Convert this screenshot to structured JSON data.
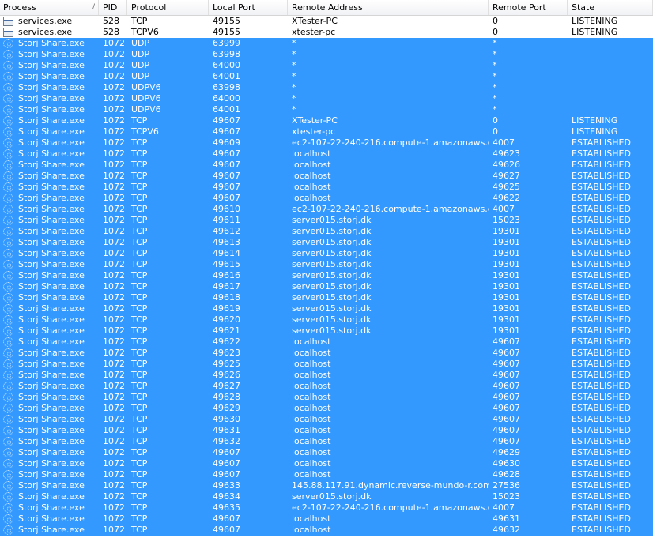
{
  "columns": [
    {
      "key": "process",
      "label": "Process",
      "sort": "/"
    },
    {
      "key": "pid",
      "label": "PID"
    },
    {
      "key": "protocol",
      "label": "Protocol"
    },
    {
      "key": "local_port",
      "label": "Local Port"
    },
    {
      "key": "remote_address",
      "label": "Remote Address"
    },
    {
      "key": "remote_port",
      "label": "Remote Port"
    },
    {
      "key": "state",
      "label": "State"
    }
  ],
  "colors": {
    "selection": "#3399ff",
    "header_bg": "#f1f2f5"
  },
  "rows": [
    {
      "icon": "services-exe-icon",
      "selected": false,
      "process": "services.exe",
      "pid": "528",
      "protocol": "TCP",
      "local_port": "49155",
      "remote_address": "XTester-PC",
      "remote_port": "0",
      "state": "LISTENING"
    },
    {
      "icon": "services-exe-icon",
      "selected": false,
      "process": "services.exe",
      "pid": "528",
      "protocol": "TCPV6",
      "local_port": "49155",
      "remote_address": "xtester-pc",
      "remote_port": "0",
      "state": "LISTENING"
    },
    {
      "icon": "storj-share-icon",
      "selected": true,
      "process": "Storj Share.exe",
      "pid": "1072",
      "protocol": "UDP",
      "local_port": "63999",
      "remote_address": "*",
      "remote_port": "*",
      "state": ""
    },
    {
      "icon": "storj-share-icon",
      "selected": true,
      "process": "Storj Share.exe",
      "pid": "1072",
      "protocol": "UDP",
      "local_port": "63998",
      "remote_address": "*",
      "remote_port": "*",
      "state": ""
    },
    {
      "icon": "storj-share-icon",
      "selected": true,
      "process": "Storj Share.exe",
      "pid": "1072",
      "protocol": "UDP",
      "local_port": "64000",
      "remote_address": "*",
      "remote_port": "*",
      "state": ""
    },
    {
      "icon": "storj-share-icon",
      "selected": true,
      "process": "Storj Share.exe",
      "pid": "1072",
      "protocol": "UDP",
      "local_port": "64001",
      "remote_address": "*",
      "remote_port": "*",
      "state": ""
    },
    {
      "icon": "storj-share-icon",
      "selected": true,
      "process": "Storj Share.exe",
      "pid": "1072",
      "protocol": "UDPV6",
      "local_port": "63998",
      "remote_address": "*",
      "remote_port": "*",
      "state": ""
    },
    {
      "icon": "storj-share-icon",
      "selected": true,
      "process": "Storj Share.exe",
      "pid": "1072",
      "protocol": "UDPV6",
      "local_port": "64000",
      "remote_address": "*",
      "remote_port": "*",
      "state": ""
    },
    {
      "icon": "storj-share-icon",
      "selected": true,
      "process": "Storj Share.exe",
      "pid": "1072",
      "protocol": "UDPV6",
      "local_port": "64001",
      "remote_address": "*",
      "remote_port": "*",
      "state": ""
    },
    {
      "icon": "storj-share-icon",
      "selected": true,
      "process": "Storj Share.exe",
      "pid": "1072",
      "protocol": "TCP",
      "local_port": "49607",
      "remote_address": "XTester-PC",
      "remote_port": "0",
      "state": "LISTENING"
    },
    {
      "icon": "storj-share-icon",
      "selected": true,
      "process": "Storj Share.exe",
      "pid": "1072",
      "protocol": "TCPV6",
      "local_port": "49607",
      "remote_address": "xtester-pc",
      "remote_port": "0",
      "state": "LISTENING"
    },
    {
      "icon": "storj-share-icon",
      "selected": true,
      "process": "Storj Share.exe",
      "pid": "1072",
      "protocol": "TCP",
      "local_port": "49609",
      "remote_address": "ec2-107-22-240-216.compute-1.amazonaws.com",
      "remote_port": "4007",
      "state": "ESTABLISHED"
    },
    {
      "icon": "storj-share-icon",
      "selected": true,
      "process": "Storj Share.exe",
      "pid": "1072",
      "protocol": "TCP",
      "local_port": "49607",
      "remote_address": "localhost",
      "remote_port": "49623",
      "state": "ESTABLISHED"
    },
    {
      "icon": "storj-share-icon",
      "selected": true,
      "process": "Storj Share.exe",
      "pid": "1072",
      "protocol": "TCP",
      "local_port": "49607",
      "remote_address": "localhost",
      "remote_port": "49626",
      "state": "ESTABLISHED"
    },
    {
      "icon": "storj-share-icon",
      "selected": true,
      "process": "Storj Share.exe",
      "pid": "1072",
      "protocol": "TCP",
      "local_port": "49607",
      "remote_address": "localhost",
      "remote_port": "49627",
      "state": "ESTABLISHED"
    },
    {
      "icon": "storj-share-icon",
      "selected": true,
      "process": "Storj Share.exe",
      "pid": "1072",
      "protocol": "TCP",
      "local_port": "49607",
      "remote_address": "localhost",
      "remote_port": "49625",
      "state": "ESTABLISHED"
    },
    {
      "icon": "storj-share-icon",
      "selected": true,
      "process": "Storj Share.exe",
      "pid": "1072",
      "protocol": "TCP",
      "local_port": "49607",
      "remote_address": "localhost",
      "remote_port": "49622",
      "state": "ESTABLISHED"
    },
    {
      "icon": "storj-share-icon",
      "selected": true,
      "process": "Storj Share.exe",
      "pid": "1072",
      "protocol": "TCP",
      "local_port": "49610",
      "remote_address": "ec2-107-22-240-216.compute-1.amazonaws.com",
      "remote_port": "4007",
      "state": "ESTABLISHED"
    },
    {
      "icon": "storj-share-icon",
      "selected": true,
      "process": "Storj Share.exe",
      "pid": "1072",
      "protocol": "TCP",
      "local_port": "49611",
      "remote_address": "server015.storj.dk",
      "remote_port": "15023",
      "state": "ESTABLISHED"
    },
    {
      "icon": "storj-share-icon",
      "selected": true,
      "process": "Storj Share.exe",
      "pid": "1072",
      "protocol": "TCP",
      "local_port": "49612",
      "remote_address": "server015.storj.dk",
      "remote_port": "19301",
      "state": "ESTABLISHED"
    },
    {
      "icon": "storj-share-icon",
      "selected": true,
      "process": "Storj Share.exe",
      "pid": "1072",
      "protocol": "TCP",
      "local_port": "49613",
      "remote_address": "server015.storj.dk",
      "remote_port": "19301",
      "state": "ESTABLISHED"
    },
    {
      "icon": "storj-share-icon",
      "selected": true,
      "process": "Storj Share.exe",
      "pid": "1072",
      "protocol": "TCP",
      "local_port": "49614",
      "remote_address": "server015.storj.dk",
      "remote_port": "19301",
      "state": "ESTABLISHED"
    },
    {
      "icon": "storj-share-icon",
      "selected": true,
      "process": "Storj Share.exe",
      "pid": "1072",
      "protocol": "TCP",
      "local_port": "49615",
      "remote_address": "server015.storj.dk",
      "remote_port": "19301",
      "state": "ESTABLISHED"
    },
    {
      "icon": "storj-share-icon",
      "selected": true,
      "process": "Storj Share.exe",
      "pid": "1072",
      "protocol": "TCP",
      "local_port": "49616",
      "remote_address": "server015.storj.dk",
      "remote_port": "19301",
      "state": "ESTABLISHED"
    },
    {
      "icon": "storj-share-icon",
      "selected": true,
      "process": "Storj Share.exe",
      "pid": "1072",
      "protocol": "TCP",
      "local_port": "49617",
      "remote_address": "server015.storj.dk",
      "remote_port": "19301",
      "state": "ESTABLISHED"
    },
    {
      "icon": "storj-share-icon",
      "selected": true,
      "process": "Storj Share.exe",
      "pid": "1072",
      "protocol": "TCP",
      "local_port": "49618",
      "remote_address": "server015.storj.dk",
      "remote_port": "19301",
      "state": "ESTABLISHED"
    },
    {
      "icon": "storj-share-icon",
      "selected": true,
      "process": "Storj Share.exe",
      "pid": "1072",
      "protocol": "TCP",
      "local_port": "49619",
      "remote_address": "server015.storj.dk",
      "remote_port": "19301",
      "state": "ESTABLISHED"
    },
    {
      "icon": "storj-share-icon",
      "selected": true,
      "process": "Storj Share.exe",
      "pid": "1072",
      "protocol": "TCP",
      "local_port": "49620",
      "remote_address": "server015.storj.dk",
      "remote_port": "19301",
      "state": "ESTABLISHED"
    },
    {
      "icon": "storj-share-icon",
      "selected": true,
      "process": "Storj Share.exe",
      "pid": "1072",
      "protocol": "TCP",
      "local_port": "49621",
      "remote_address": "server015.storj.dk",
      "remote_port": "19301",
      "state": "ESTABLISHED"
    },
    {
      "icon": "storj-share-icon",
      "selected": true,
      "process": "Storj Share.exe",
      "pid": "1072",
      "protocol": "TCP",
      "local_port": "49622",
      "remote_address": "localhost",
      "remote_port": "49607",
      "state": "ESTABLISHED"
    },
    {
      "icon": "storj-share-icon",
      "selected": true,
      "process": "Storj Share.exe",
      "pid": "1072",
      "protocol": "TCP",
      "local_port": "49623",
      "remote_address": "localhost",
      "remote_port": "49607",
      "state": "ESTABLISHED"
    },
    {
      "icon": "storj-share-icon",
      "selected": true,
      "process": "Storj Share.exe",
      "pid": "1072",
      "protocol": "TCP",
      "local_port": "49625",
      "remote_address": "localhost",
      "remote_port": "49607",
      "state": "ESTABLISHED"
    },
    {
      "icon": "storj-share-icon",
      "selected": true,
      "process": "Storj Share.exe",
      "pid": "1072",
      "protocol": "TCP",
      "local_port": "49626",
      "remote_address": "localhost",
      "remote_port": "49607",
      "state": "ESTABLISHED"
    },
    {
      "icon": "storj-share-icon",
      "selected": true,
      "process": "Storj Share.exe",
      "pid": "1072",
      "protocol": "TCP",
      "local_port": "49627",
      "remote_address": "localhost",
      "remote_port": "49607",
      "state": "ESTABLISHED"
    },
    {
      "icon": "storj-share-icon",
      "selected": true,
      "process": "Storj Share.exe",
      "pid": "1072",
      "protocol": "TCP",
      "local_port": "49628",
      "remote_address": "localhost",
      "remote_port": "49607",
      "state": "ESTABLISHED"
    },
    {
      "icon": "storj-share-icon",
      "selected": true,
      "process": "Storj Share.exe",
      "pid": "1072",
      "protocol": "TCP",
      "local_port": "49629",
      "remote_address": "localhost",
      "remote_port": "49607",
      "state": "ESTABLISHED"
    },
    {
      "icon": "storj-share-icon",
      "selected": true,
      "process": "Storj Share.exe",
      "pid": "1072",
      "protocol": "TCP",
      "local_port": "49630",
      "remote_address": "localhost",
      "remote_port": "49607",
      "state": "ESTABLISHED"
    },
    {
      "icon": "storj-share-icon",
      "selected": true,
      "process": "Storj Share.exe",
      "pid": "1072",
      "protocol": "TCP",
      "local_port": "49631",
      "remote_address": "localhost",
      "remote_port": "49607",
      "state": "ESTABLISHED"
    },
    {
      "icon": "storj-share-icon",
      "selected": true,
      "process": "Storj Share.exe",
      "pid": "1072",
      "protocol": "TCP",
      "local_port": "49632",
      "remote_address": "localhost",
      "remote_port": "49607",
      "state": "ESTABLISHED"
    },
    {
      "icon": "storj-share-icon",
      "selected": true,
      "process": "Storj Share.exe",
      "pid": "1072",
      "protocol": "TCP",
      "local_port": "49607",
      "remote_address": "localhost",
      "remote_port": "49629",
      "state": "ESTABLISHED"
    },
    {
      "icon": "storj-share-icon",
      "selected": true,
      "process": "Storj Share.exe",
      "pid": "1072",
      "protocol": "TCP",
      "local_port": "49607",
      "remote_address": "localhost",
      "remote_port": "49630",
      "state": "ESTABLISHED"
    },
    {
      "icon": "storj-share-icon",
      "selected": true,
      "process": "Storj Share.exe",
      "pid": "1072",
      "protocol": "TCP",
      "local_port": "49607",
      "remote_address": "localhost",
      "remote_port": "49628",
      "state": "ESTABLISHED"
    },
    {
      "icon": "storj-share-icon",
      "selected": true,
      "process": "Storj Share.exe",
      "pid": "1072",
      "protocol": "TCP",
      "local_port": "49633",
      "remote_address": "145.88.117.91.dynamic.reverse-mundo-r.com",
      "remote_port": "27536",
      "state": "ESTABLISHED"
    },
    {
      "icon": "storj-share-icon",
      "selected": true,
      "process": "Storj Share.exe",
      "pid": "1072",
      "protocol": "TCP",
      "local_port": "49634",
      "remote_address": "server015.storj.dk",
      "remote_port": "15023",
      "state": "ESTABLISHED"
    },
    {
      "icon": "storj-share-icon",
      "selected": true,
      "process": "Storj Share.exe",
      "pid": "1072",
      "protocol": "TCP",
      "local_port": "49635",
      "remote_address": "ec2-107-22-240-216.compute-1.amazonaws.com",
      "remote_port": "4007",
      "state": "ESTABLISHED"
    },
    {
      "icon": "storj-share-icon",
      "selected": true,
      "process": "Storj Share.exe",
      "pid": "1072",
      "protocol": "TCP",
      "local_port": "49607",
      "remote_address": "localhost",
      "remote_port": "49631",
      "state": "ESTABLISHED"
    },
    {
      "icon": "storj-share-icon",
      "selected": true,
      "process": "Storj Share.exe",
      "pid": "1072",
      "protocol": "TCP",
      "local_port": "49607",
      "remote_address": "localhost",
      "remote_port": "49632",
      "state": "ESTABLISHED"
    }
  ]
}
